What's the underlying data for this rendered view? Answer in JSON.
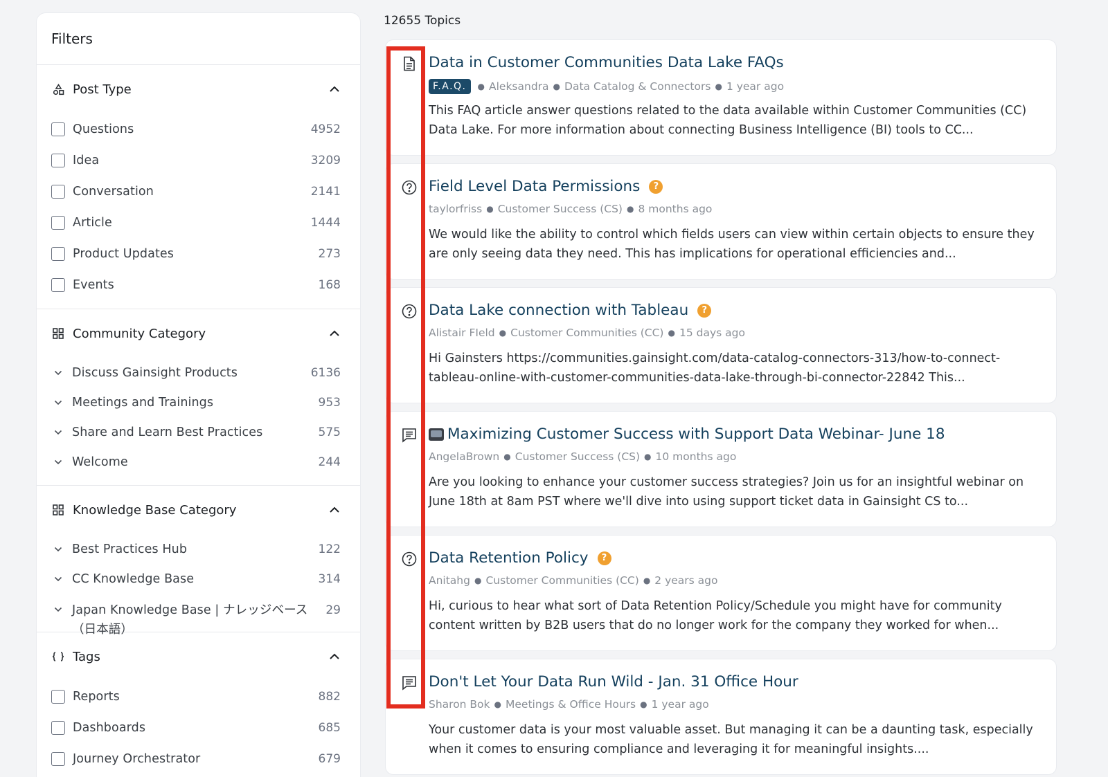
{
  "filters_title": "Filters",
  "topics_count": "12655 Topics",
  "post_type": {
    "title": "Post Type",
    "items": [
      {
        "label": "Questions",
        "count": "4952"
      },
      {
        "label": "Idea",
        "count": "3209"
      },
      {
        "label": "Conversation",
        "count": "2141"
      },
      {
        "label": "Article",
        "count": "1444"
      },
      {
        "label": "Product Updates",
        "count": "273"
      },
      {
        "label": "Events",
        "count": "168"
      }
    ]
  },
  "community_category": {
    "title": "Community Category",
    "items": [
      {
        "label": "Discuss Gainsight Products",
        "count": "6136"
      },
      {
        "label": "Meetings and Trainings",
        "count": "953"
      },
      {
        "label": "Share and Learn Best Practices",
        "count": "575"
      },
      {
        "label": "Welcome",
        "count": "244"
      }
    ]
  },
  "kb_category": {
    "title": "Knowledge Base Category",
    "items": [
      {
        "label": "Best Practices Hub",
        "count": "122"
      },
      {
        "label": "CC Knowledge Base",
        "count": "314"
      },
      {
        "label": "Japan Knowledge Base | ナレッジベース（日本語）",
        "count": "29"
      }
    ]
  },
  "tags": {
    "title": "Tags",
    "items": [
      {
        "label": "Reports",
        "count": "882"
      },
      {
        "label": "Dashboards",
        "count": "685"
      },
      {
        "label": "Journey Orchestrator",
        "count": "679"
      }
    ]
  },
  "posts": [
    {
      "icon": "document-icon",
      "title": "Data in Customer Communities Data Lake FAQs",
      "badge": "F.A.Q.",
      "author": "Aleksandra",
      "category": "Data Catalog & Connectors",
      "time": "1 year ago",
      "excerpt": "This FAQ article answer questions related to the data available within Customer Communities (CC) Data Lake. For more information about connecting Business Intelligence (BI) tools to CC..."
    },
    {
      "icon": "question-circle-icon",
      "title": "Field Level Data Permissions",
      "answered": "?",
      "author": "taylorfriss",
      "category": "Customer Success (CS)",
      "time": "8 months ago",
      "excerpt": "We would like the ability to control which fields users can view within certain objects to ensure they are only seeing data they need. This has implications for operational efficiencies and..."
    },
    {
      "icon": "question-circle-icon",
      "title": "Data Lake connection with Tableau",
      "answered": "?",
      "author": "Alistair FIeld",
      "category": "Customer Communities (CC)",
      "time": "15 days ago",
      "excerpt": "Hi Gainsters https://communities.gainsight.com/data-catalog-connectors-313/how-to-connect-tableau-online-with-customer-communities-data-lake-through-bi-connector-22842 This..."
    },
    {
      "icon": "chat-icon",
      "title": "Maximizing Customer Success with Support Data Webinar- June 18",
      "author": "AngelaBrown",
      "category": "Customer Success (CS)",
      "time": "10 months ago",
      "excerpt": "Are you looking to enhance your customer success strategies? Join us for an insightful webinar on June 18th at 8am PST where we'll dive into using support ticket data in Gainsight CS to..."
    },
    {
      "icon": "question-circle-icon",
      "title": "Data Retention Policy",
      "answered": "?",
      "author": "Anitahg",
      "category": "Customer Communities (CC)",
      "time": "2 years ago",
      "excerpt": "Hi, curious to hear what sort of Data Retention Policy/Schedule you might have for community content written by B2B users that do no longer work for the company they worked for when..."
    },
    {
      "icon": "chat-icon",
      "title": "Don't Let Your Data Run Wild - Jan. 31 Office Hour",
      "author": "Sharon Bok",
      "category": "Meetings & Office Hours",
      "time": "1 year ago",
      "excerpt": "Your customer data is your most valuable asset. But managing it can be a daunting task, especially when it comes to ensuring compliance and leveraging it for meaningful insights...."
    }
  ],
  "colors": {
    "accent": "#133f5c",
    "highlight": "#e32d1f",
    "answered_badge": "#f0a030",
    "faq_badge": "#1c4a68"
  }
}
